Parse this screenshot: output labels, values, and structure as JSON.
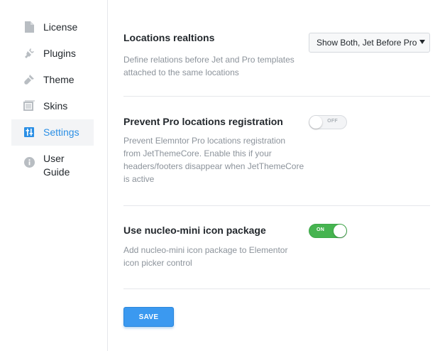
{
  "sidebar": {
    "items": [
      {
        "label": "License",
        "icon": "document-icon",
        "active": false
      },
      {
        "label": "Plugins",
        "icon": "plug-icon",
        "active": false
      },
      {
        "label": "Theme",
        "icon": "brush-icon",
        "active": false
      },
      {
        "label": "Skins",
        "icon": "skins-icon",
        "active": false
      },
      {
        "label": "Settings",
        "icon": "sliders-icon",
        "active": true
      },
      {
        "label": "User Guide",
        "icon": "info-icon",
        "active": false
      }
    ]
  },
  "settings": {
    "locations": {
      "title": "Locations realtions",
      "description": "Define relations before Jet and Pro templates attached to the same locations",
      "select_value": "Show Both, Jet Before Pro"
    },
    "prevent_pro": {
      "title": "Prevent Pro locations registration",
      "description": "Prevent Elemntor Pro locations registration from JetThemeCore. Enable this if your headers/footers disappear when JetThemeCore is active",
      "toggle_label": "OFF",
      "toggle_on": false
    },
    "nucleo": {
      "title": "Use nucleo-mini icon package",
      "description": "Add nucleo-mini icon package to Elementor icon picker control",
      "toggle_label": "ON",
      "toggle_on": true
    }
  },
  "save_label": "SAVE",
  "colors": {
    "accent": "#2b8fe5",
    "toggle_on": "#46b450",
    "save_button": "#3b99f0"
  }
}
